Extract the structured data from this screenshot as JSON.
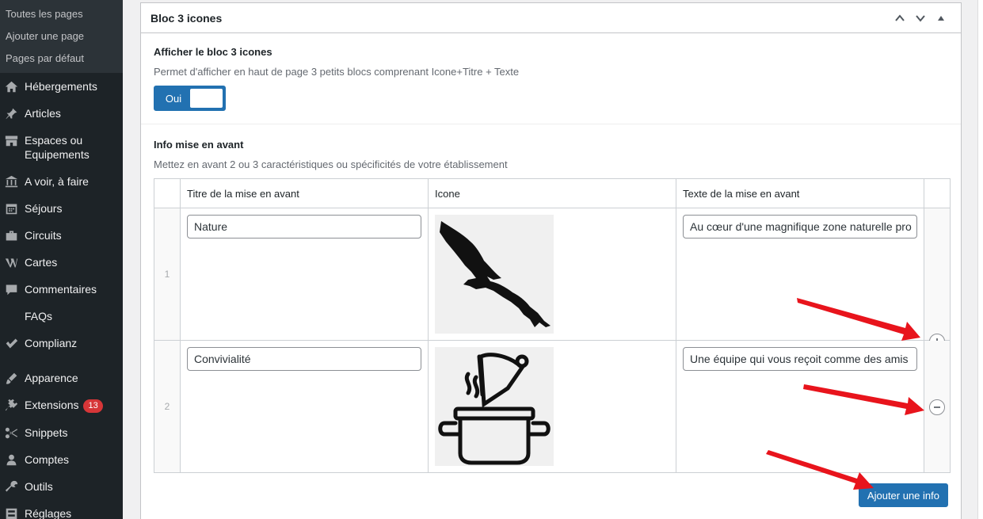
{
  "sidebar": {
    "submenu": [
      "Toutes les pages",
      "Ajouter une page",
      "Pages par défaut"
    ],
    "items": [
      {
        "label": "Hébergements",
        "icon": "home-icon"
      },
      {
        "label": "Articles",
        "icon": "pin-icon"
      },
      {
        "label": "Espaces ou\nEquipements",
        "icon": "store-icon"
      },
      {
        "label": "A voir, à faire",
        "icon": "bank-icon"
      },
      {
        "label": "Séjours",
        "icon": "calendar-icon"
      },
      {
        "label": "Circuits",
        "icon": "portfolio-icon"
      },
      {
        "label": "Cartes",
        "icon": "wordpress-w-icon"
      },
      {
        "label": "Commentaires",
        "icon": "comment-icon"
      },
      {
        "label": "FAQs",
        "icon": ""
      },
      {
        "label": "Complianz",
        "icon": "check-icon"
      },
      {
        "label": "Apparence",
        "icon": "brush-icon"
      },
      {
        "label": "Extensions",
        "icon": "plugin-icon",
        "badge": "13"
      },
      {
        "label": "Snippets",
        "icon": "scissors-icon"
      },
      {
        "label": "Comptes",
        "icon": "user-icon"
      },
      {
        "label": "Outils",
        "icon": "wrench-icon"
      },
      {
        "label": "Réglages",
        "icon": "settings-icon"
      }
    ]
  },
  "panel": {
    "title": "Bloc 3 icones",
    "field1": {
      "label": "Afficher le bloc 3 icones",
      "desc": "Permet d'afficher en haut de page 3 petits blocs comprenant Icone+Titre + Texte",
      "toggle_on": "Oui"
    },
    "field2": {
      "label": "Info mise en avant",
      "desc": "Mettez en avant 2 ou 3 caractéristiques ou spécificités de votre établissement",
      "columns": [
        "Titre de la mise en avant",
        "Icone",
        "Texte de la mise en avant"
      ],
      "rows": [
        {
          "num": "1",
          "title": "Nature",
          "icon": "eagle-icon",
          "text": "Au cœur d'une magnifique zone naturelle pro"
        },
        {
          "num": "2",
          "title": "Convivialité",
          "icon": "pot-icon",
          "text": "Une équipe qui vous reçoit comme des amis"
        }
      ],
      "add_button": "Ajouter une info"
    }
  },
  "colors": {
    "accent": "#2271b1",
    "sidebar": "#1d2327",
    "arrow": "#e8141c"
  }
}
